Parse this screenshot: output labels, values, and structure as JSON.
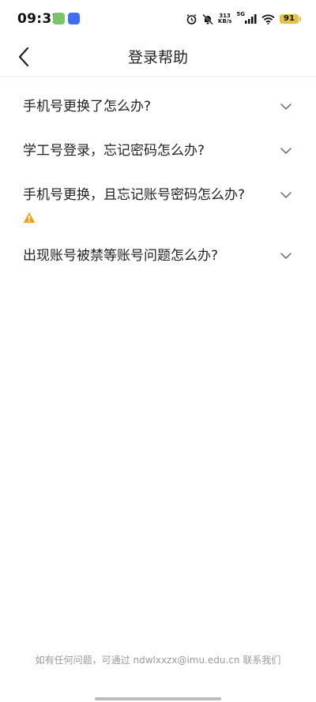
{
  "status_bar": {
    "time": "09:32",
    "net_speed_value": "313",
    "net_speed_unit": "KB/s",
    "network": "5G",
    "battery": "91",
    "icons": [
      "alarm-icon",
      "mute-icon",
      "signal-icon",
      "wifi-icon",
      "battery-icon"
    ]
  },
  "header": {
    "title": "登录帮助",
    "back_icon": "back-arrow-icon"
  },
  "faq": [
    {
      "question": "手机号更换了怎么办?",
      "icon": "chevron-down-icon",
      "warning": false
    },
    {
      "question": "学工号登录，忘记密码怎么办?",
      "icon": "chevron-down-icon",
      "warning": false
    },
    {
      "question": "手机号更换，且忘记账号密码怎么办?",
      "icon": "chevron-down-icon",
      "warning": true
    },
    {
      "question": "出现账号被禁等账号问题怎么办?",
      "icon": "chevron-down-icon",
      "warning": false
    }
  ],
  "footer": {
    "note": "如有任何问题，可通过 ndwlxxzx@imu.edu.cn 联系我们"
  },
  "colors": {
    "warning": "#f0a020",
    "battery": "#e1c24c",
    "footer_text": "#9a9a9a"
  }
}
